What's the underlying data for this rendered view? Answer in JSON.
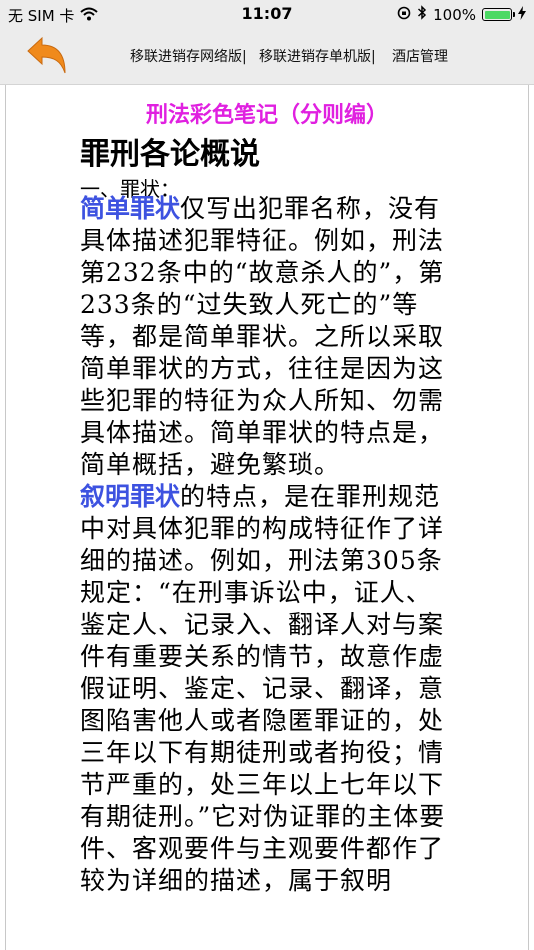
{
  "status": {
    "carrier": "无 SIM 卡",
    "time": "11:07",
    "battery": "100%",
    "battery_color": "#4cd964"
  },
  "nav": {
    "back_icon": "undo-arrow-icon",
    "back_color": "#f08a1c",
    "links": [
      "移联进销存网络版|",
      "移联进销存单机版|",
      "酒店管理"
    ]
  },
  "document": {
    "title": "刑法彩色笔记（分则编）",
    "title_color": "#e020e0",
    "heading": "罪刑各论概说",
    "subheading": "一、罪状：",
    "term_color": "#3d52e0",
    "paragraphs": [
      {
        "term": "简单罪状",
        "text": "仅写出犯罪名称，没有具体描述犯罪特征。例如，刑法第232条中的“故意杀人的”，第233条的“过失致人死亡的”等等，都是简单罪状。之所以采取简单罪状的方式，往往是因为这些犯罪的特征为众人所知、勿需具体描述。简单罪状的特点是，简单概括，避免繁琐。"
      },
      {
        "term": "叙明罪状",
        "text": "的特点，是在罪刑规范中对具体犯罪的构成特征作了详细的描述。例如，刑法第305条规定：“在刑事诉讼中，证人、鉴定人、记录入、翻译人对与案件有重要关系的情节，故意作虚假证明、鉴定、记录、翻译，意图陷害他人或者隐匿罪证的，处三年以下有期徒刑或者拘役；情节严重的，处三年以上七年以下有期徒刑。”它对伪证罪的主体要件、客观要件与主观要件都作了较为详细的描述，属于叙明"
      }
    ]
  }
}
